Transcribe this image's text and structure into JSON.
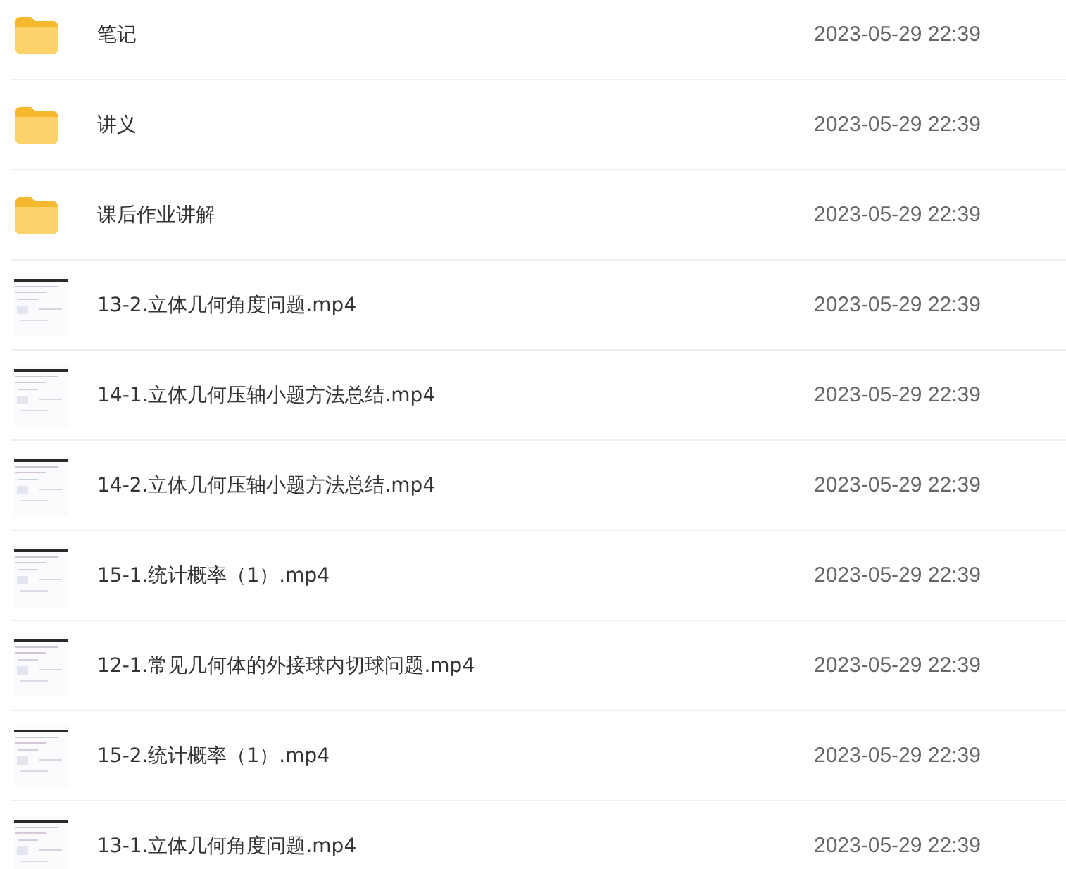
{
  "files": [
    {
      "kind": "folder",
      "name": "笔记",
      "modified": "2023-05-29 22:39"
    },
    {
      "kind": "folder",
      "name": "讲义",
      "modified": "2023-05-29 22:39"
    },
    {
      "kind": "folder",
      "name": "课后作业讲解",
      "modified": "2023-05-29 22:39"
    },
    {
      "kind": "video",
      "name": "13-2.立体几何角度问题.mp4",
      "modified": "2023-05-29 22:39"
    },
    {
      "kind": "video",
      "name": "14-1.立体几何压轴小题方法总结.mp4",
      "modified": "2023-05-29 22:39"
    },
    {
      "kind": "video",
      "name": "14-2.立体几何压轴小题方法总结.mp4",
      "modified": "2023-05-29 22:39"
    },
    {
      "kind": "video",
      "name": "15-1.统计概率（1）.mp4",
      "modified": "2023-05-29 22:39"
    },
    {
      "kind": "video",
      "name": "12-1.常见几何体的外接球内切球问题.mp4",
      "modified": "2023-05-29 22:39"
    },
    {
      "kind": "video",
      "name": "15-2.统计概率（1）.mp4",
      "modified": "2023-05-29 22:39"
    },
    {
      "kind": "video",
      "name": "13-1.立体几何角度问题.mp4",
      "modified": "2023-05-29 22:39"
    }
  ]
}
